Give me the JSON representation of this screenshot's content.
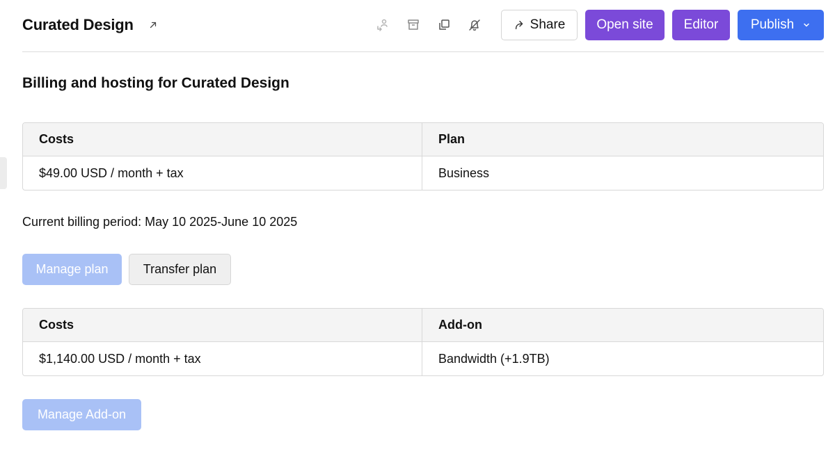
{
  "header": {
    "site_title": "Curated Design",
    "icons": [
      "transfer-icon",
      "archive-icon",
      "duplicate-icon",
      "notifications-off-icon"
    ],
    "share_label": "Share",
    "open_site_label": "Open site",
    "editor_label": "Editor",
    "publish_label": "Publish"
  },
  "page": {
    "title": "Billing and hosting for Curated Design",
    "billing_period": "Current billing period: May 10 2025-June 10 2025"
  },
  "plan_table": {
    "headers": [
      "Costs",
      "Plan"
    ],
    "rows": [
      [
        "$49.00 USD / month + tax",
        "Business"
      ]
    ]
  },
  "plan_actions": {
    "manage_label": "Manage plan",
    "transfer_label": "Transfer plan"
  },
  "addon_table": {
    "headers": [
      "Costs",
      "Add-on"
    ],
    "rows": [
      [
        "$1,140.00 USD / month + tax",
        "Bandwidth (+1.9TB)"
      ]
    ]
  },
  "addon_actions": {
    "manage_label": "Manage Add-on"
  },
  "colors": {
    "purple": "#7b4ad9",
    "blue": "#3d6ff0",
    "disabled_blue": "#a9c1f6"
  }
}
